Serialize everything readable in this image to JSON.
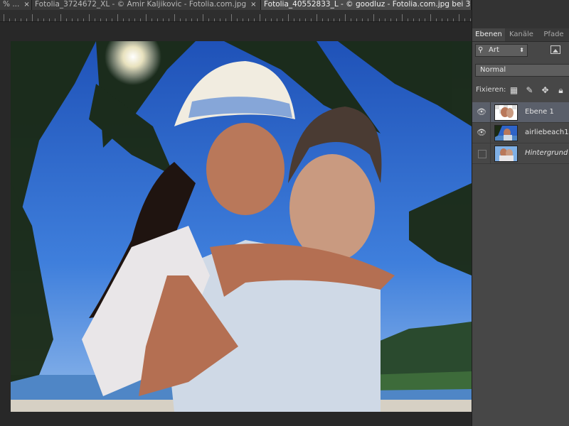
{
  "document_tabs": [
    {
      "title": "% ...",
      "close_icon": "×",
      "active": false
    },
    {
      "title": "Fotolia_3724672_XL - © Amir Kaljikovic - Fotolia.com.jpg",
      "close_icon": "×",
      "active": false
    },
    {
      "title": "Fotolia_40552833_L - © goodluz - Fotolia.com.jpg bei 3",
      "close_icon": "",
      "active": true
    }
  ],
  "panel": {
    "tabs": [
      "Ebenen",
      "Kanäle",
      "Pfade"
    ],
    "active_tab": "Ebenen",
    "filter_kind": "Art",
    "blend_mode": "Normal",
    "lock_label": "Fixieren:",
    "layers": [
      {
        "name": "Ebene 1",
        "visible": true,
        "selected": true,
        "italic": false
      },
      {
        "name": "airliebeach1",
        "visible": true,
        "selected": false,
        "italic": false
      },
      {
        "name": "Hintergrund",
        "visible": false,
        "selected": false,
        "italic": true
      }
    ]
  },
  "colors": {
    "app_bg": "#282828",
    "panel_bg": "#474747",
    "selected_layer": "#5a5f6a",
    "sky": "#2f64c8"
  },
  "icons": {
    "search": "magnifier-icon",
    "eye": "eye-icon",
    "lock_pixels": "checkerboard-icon",
    "lock_paint": "brush-icon",
    "lock_move": "move-icon",
    "lock_all": "lock-icon",
    "image_filter": "image-filter-icon"
  }
}
